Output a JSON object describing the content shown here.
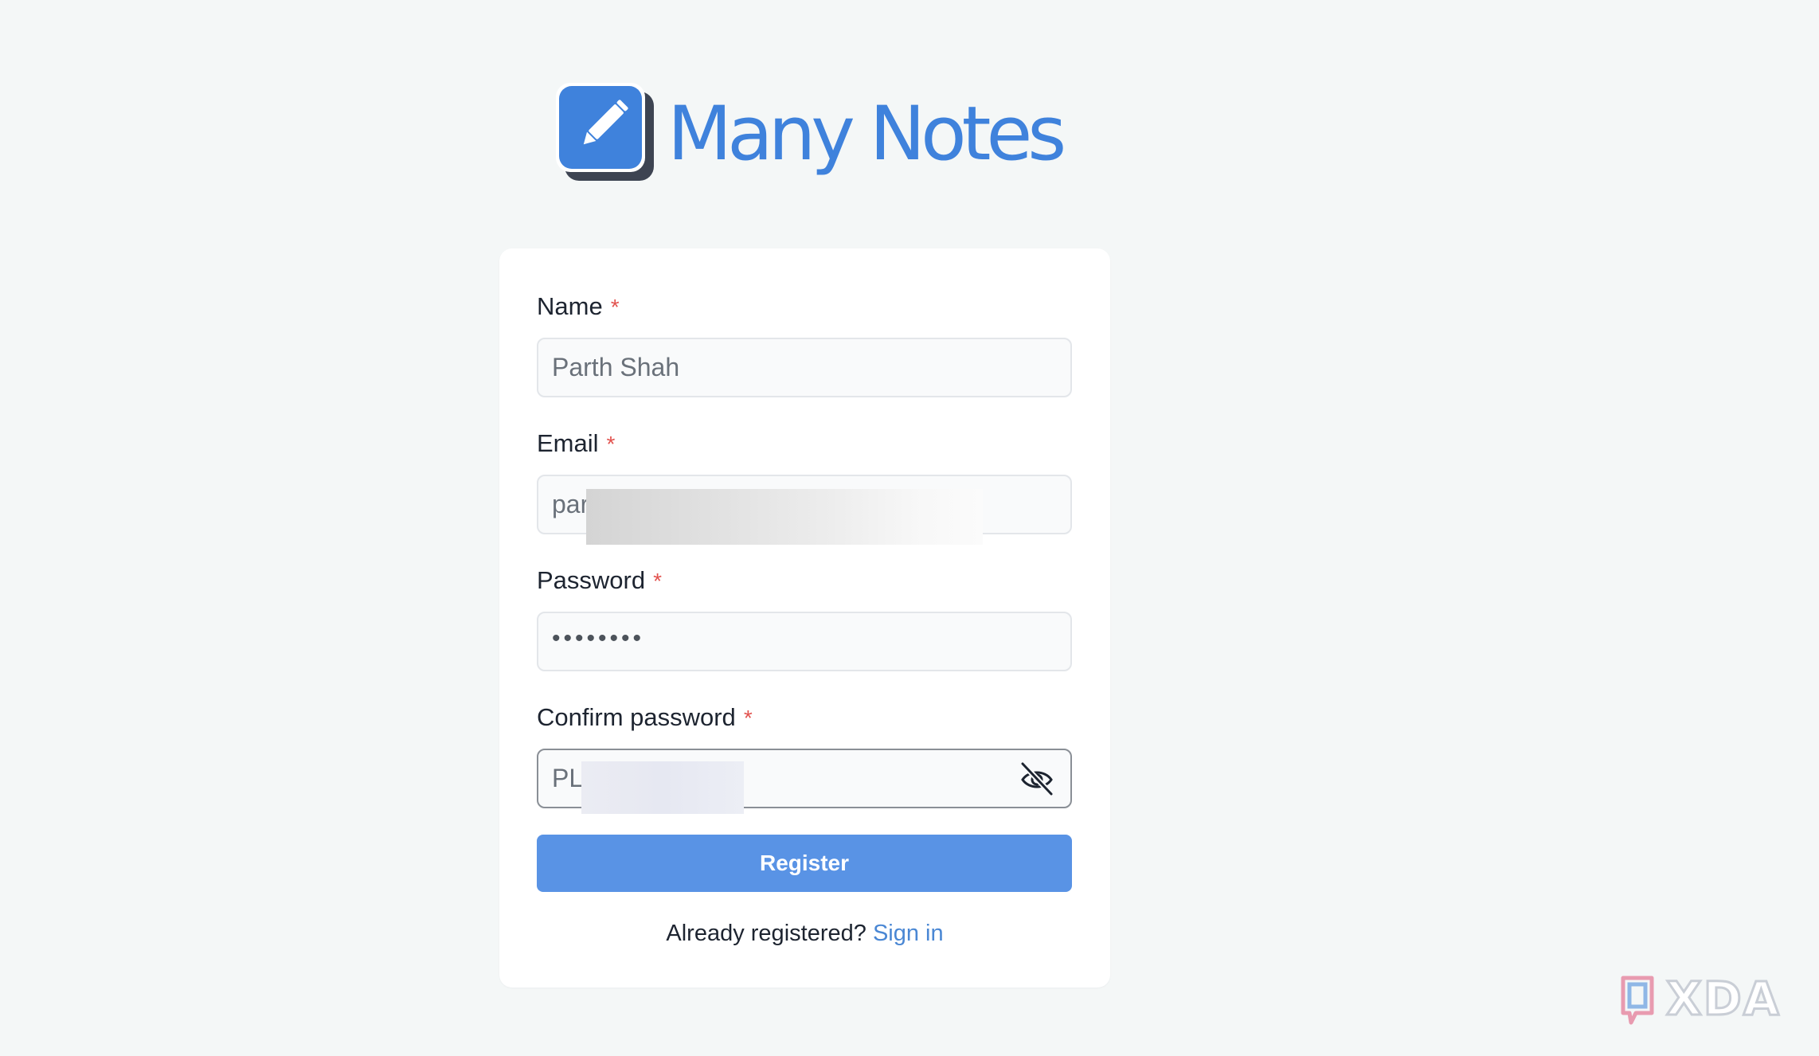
{
  "app": {
    "name": "Many Notes",
    "logo_icon": "pencil-note-icon",
    "accent_color": "#3f82dc"
  },
  "form": {
    "fields": [
      {
        "label": "Name",
        "required_mark": "*",
        "value": "Parth Shah"
      },
      {
        "label": "Email",
        "required_mark": "*",
        "value": "par"
      },
      {
        "label": "Password",
        "required_mark": "*",
        "value": "••••••••"
      },
      {
        "label": "Confirm password",
        "required_mark": "*",
        "value": "PL",
        "toggle_icon": "eye-slash-icon"
      }
    ],
    "submit_label": "Register",
    "submit_color": "#5993e5",
    "footer": {
      "prompt": "Already registered?",
      "link_label": "Sign in"
    }
  },
  "watermark": {
    "text": "XDA",
    "icon": "xda-logo-icon"
  }
}
